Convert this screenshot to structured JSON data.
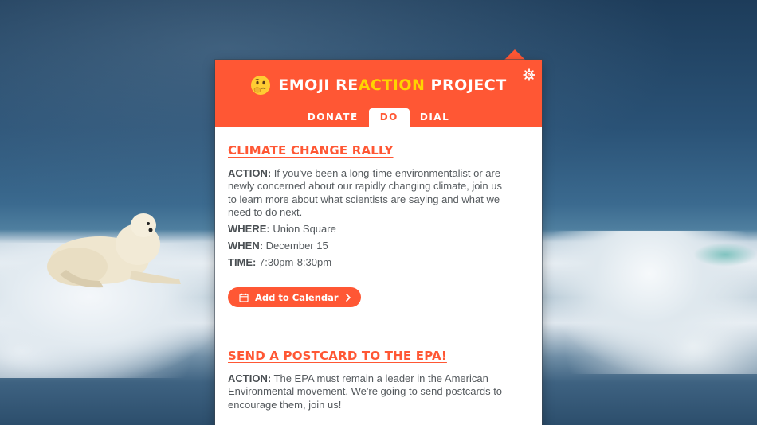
{
  "app": {
    "title_part1": "EMOJI RE",
    "title_highlight": "ACTION",
    "title_part2": " PROJECT",
    "emoji_icon": "thinking-face-emoji",
    "settings_icon": "gear-icon"
  },
  "colors": {
    "brand": "#ff5734",
    "highlight": "#ffd400",
    "text": "#555a5e"
  },
  "tabs": [
    {
      "label": "DONATE",
      "active": false
    },
    {
      "label": "DO",
      "active": true
    },
    {
      "label": "DIAL",
      "active": false
    }
  ],
  "events": [
    {
      "title": "CLIMATE CHANGE RALLY",
      "action_label": "ACTION:",
      "action_text": " If you've been a long-time environmentalist or are newly concerned about our rapidly changing climate, join us to learn more about what scientists are saying and what we need to do next.",
      "where_label": "WHERE:",
      "where_value": " Union Square",
      "when_label": "WHEN:",
      "when_value": " December 15",
      "time_label": "TIME:",
      "time_value": " 7:30pm-8:30pm",
      "button_label": "Add to Calendar",
      "button_icon": "calendar-icon"
    },
    {
      "title": "SEND A POSTCARD TO THE EPA!",
      "action_label": "ACTION:",
      "action_text": " The EPA must remain a leader in the American Environmental movement. We're going to send postcards to encourage them, join us!"
    }
  ],
  "background": {
    "description_icon": "polar-bear-on-ice"
  }
}
